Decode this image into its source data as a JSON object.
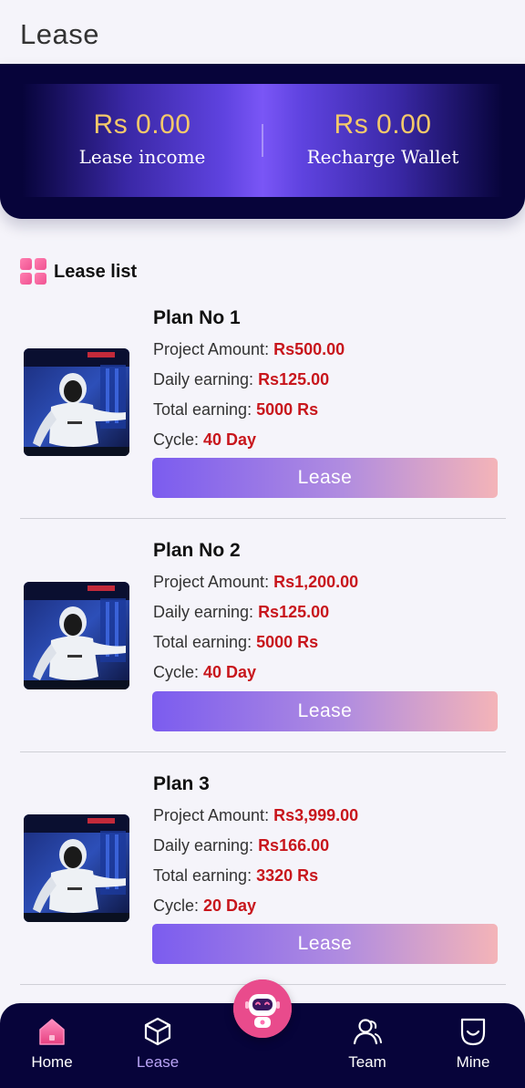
{
  "header": {
    "title": "Lease"
  },
  "summary": {
    "lease_income": {
      "amount": "Rs 0.00",
      "label": "Lease income"
    },
    "recharge_wallet": {
      "amount": "Rs 0.00",
      "label": "Recharge Wallet"
    }
  },
  "lease_list": {
    "title": "Lease list",
    "plans": [
      {
        "name": "Plan No 1",
        "project_amount_label": "Project Amount: ",
        "project_amount": "Rs500.00",
        "daily_earning_label": "Daily earning: ",
        "daily_earning": "Rs125.00",
        "total_earning_label": "Total earning: ",
        "total_earning": "5000 Rs",
        "cycle_label": "Cycle: ",
        "cycle": "40 Day",
        "button": "Lease"
      },
      {
        "name": "Plan No 2",
        "project_amount_label": "Project Amount: ",
        "project_amount": "Rs1,200.00",
        "daily_earning_label": "Daily earning: ",
        "daily_earning": "Rs125.00",
        "total_earning_label": "Total earning: ",
        "total_earning": "5000 Rs",
        "cycle_label": "Cycle: ",
        "cycle": "40 Day",
        "button": "Lease"
      },
      {
        "name": "Plan 3",
        "project_amount_label": "Project Amount: ",
        "project_amount": "Rs3,999.00",
        "daily_earning_label": "Daily earning: ",
        "daily_earning": "Rs166.00",
        "total_earning_label": "Total earning: ",
        "total_earning": "3320 Rs",
        "cycle_label": "Cycle: ",
        "cycle": "20 Day",
        "button": "Lease"
      }
    ]
  },
  "nav": {
    "items": [
      {
        "label": "Home",
        "icon": "home-icon"
      },
      {
        "label": "Lease",
        "icon": "cube-icon",
        "active": true
      },
      {
        "label": "Team",
        "icon": "team-icon"
      },
      {
        "label": "Mine",
        "icon": "mine-icon"
      }
    ],
    "center_icon": "robot-icon"
  },
  "colors": {
    "navy": "#07043a",
    "gold": "#f4c96a",
    "value_red": "#c8161c",
    "accent_pink": "#f05292",
    "button_gradient": [
      "#7b5cef",
      "#f4b4b8"
    ]
  }
}
